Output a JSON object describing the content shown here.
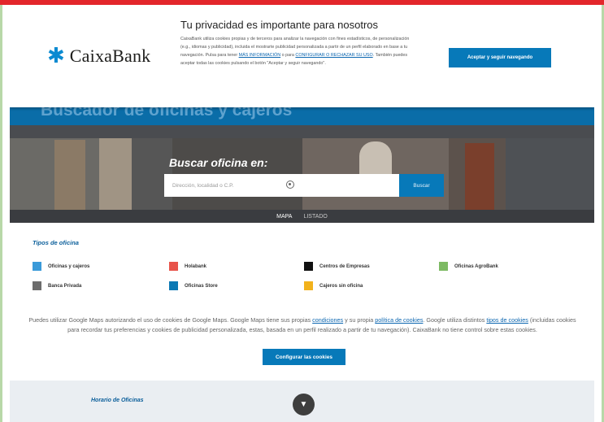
{
  "cookie_banner": {
    "logo_text": "CaixaBank",
    "title": "Tu privacidad es importante para nosotros",
    "text_part1": "CaixaBank utiliza cookies propias y de terceros para analizar la navegación con fines estadísticos, de personalización (e.g., idiomas y publicidad), incluida el mostrarte publicidad personalizada a partir de un perfil elaborado en base a tu navegación. Pulsa para tener ",
    "link_more": "MÁS INFORMACIÓN",
    "text_part2": " o para ",
    "link_config": "CONFIGURAR O RECHAZAR SU USO",
    "text_part3": ". También puedes aceptar todas las cookies pulsando el botón \"Aceptar y seguir navegando\".",
    "accept_label": "Aceptar y seguir navegando"
  },
  "header": {
    "page_title": "Buscador de oficinas y cajeros"
  },
  "search": {
    "label": "Buscar oficina en:",
    "placeholder": "Dirección, localidad o C.P.",
    "button_label": "Buscar"
  },
  "tabs": [
    {
      "label": "MAPA",
      "active": true
    },
    {
      "label": "LISTADO",
      "active": false
    }
  ],
  "types": {
    "title": "Tipos de oficina",
    "items": [
      {
        "label": "Oficinas y cajeros",
        "color": "#3a9ad9"
      },
      {
        "label": "Holabank",
        "color": "#e8534a"
      },
      {
        "label": "Centros de Empresas",
        "color": "#111111"
      },
      {
        "label": "Oficinas AgroBank",
        "color": "#7dba63"
      },
      {
        "label": "Banca Privada",
        "color": "#6d6d6d"
      },
      {
        "label": "Oficinas Store",
        "color": "#0b78b4"
      },
      {
        "label": "Cajeros sin oficina",
        "color": "#f2b21c"
      }
    ]
  },
  "maps_notice": {
    "text_a": "Puedes utilizar Google Maps autorizando el uso de cookies de Google Maps. Google Maps tiene sus propias ",
    "link_conditions": "condiciones",
    "text_b": " y su propia ",
    "link_policy": "política de cookies",
    "text_c": ". Google utiliza distintos ",
    "link_types": "tipos de cookies",
    "text_d": " (incluidas cookies para recordar tus preferencias y cookies de publicidad personalizada, estas, basada en un perfil realizado a partir de tu navegación). CaixaBank no tiene control sobre estas cookies.",
    "config_label": "Configurar las cookies"
  },
  "hours": {
    "title": "Horario de Oficinas"
  },
  "icons": {
    "logo": "caixabank-star-icon",
    "locate": "location-target-icon",
    "scroll": "chevron-down-icon"
  }
}
